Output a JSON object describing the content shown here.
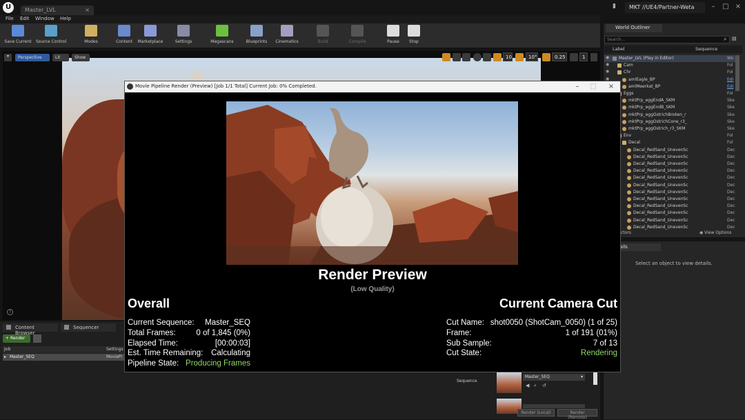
{
  "titlebar": {
    "doc_tab": "Master_LVL",
    "project": "MKT //UE4/Partner-Weta",
    "logo": "U"
  },
  "menu": [
    "File",
    "Edit",
    "Window",
    "Help"
  ],
  "toolbar": [
    {
      "label": "Save Current",
      "icon": "save-icon",
      "color": "#5a8ad8",
      "disabled": false
    },
    {
      "label": "Source Control",
      "icon": "source-control-icon",
      "color": "#5aa0c8",
      "disabled": false
    },
    {
      "label": "Modes",
      "icon": "modes-icon",
      "color": "#d0b060",
      "disabled": false
    },
    {
      "label": "Content",
      "icon": "content-icon",
      "color": "#6a8acc",
      "disabled": false
    },
    {
      "label": "Marketplace",
      "icon": "marketplace-icon",
      "color": "#8a9ad8",
      "disabled": false
    },
    {
      "label": "Settings",
      "icon": "settings-icon",
      "color": "#8a8aa8",
      "disabled": false
    },
    {
      "label": "Megascans",
      "icon": "megascans-icon",
      "color": "#6cc040",
      "disabled": false
    },
    {
      "label": "Blueprints",
      "icon": "blueprints-icon",
      "color": "#8aa0c8",
      "disabled": false
    },
    {
      "label": "Cinematics",
      "icon": "cinematics-icon",
      "color": "#a0a0c0",
      "disabled": false
    },
    {
      "label": "Build",
      "icon": "build-icon",
      "color": "#555555",
      "disabled": true
    },
    {
      "label": "Compile",
      "icon": "compile-icon",
      "color": "#555555",
      "disabled": true
    },
    {
      "label": "Pause",
      "icon": "pause-icon",
      "color": "#dcdcdc",
      "disabled": false
    },
    {
      "label": "Stop",
      "icon": "stop-icon",
      "color": "#dcdcdc",
      "disabled": false
    }
  ],
  "viewport": {
    "perspective": "Perspective",
    "lit": "Lit",
    "show": "Show",
    "grid_snap": "10",
    "rot_snap": "10°",
    "scale_snap": "0.25",
    "cam_speed": "1"
  },
  "outliner": {
    "tab": "World Outliner",
    "search_placeholder": "Search...",
    "col_label": "Label",
    "col_type": "Sequence",
    "rows": [
      {
        "name": "Master_LVL (Play in Editor)",
        "type": "Wo",
        "indent": 0,
        "kind": "level"
      },
      {
        "name": "Cam",
        "type": "Fol",
        "indent": 1,
        "kind": "folder"
      },
      {
        "name": "Chr",
        "type": "Fol",
        "indent": 1,
        "kind": "folder"
      },
      {
        "name": "amlEagle_BP",
        "type": "Edi",
        "indent": 2,
        "kind": "actor"
      },
      {
        "name": "amlMeerkat_BP",
        "type": "Edi",
        "indent": 2,
        "kind": "actor"
      },
      {
        "name": "Eggs",
        "type": "Fol",
        "indent": 1,
        "kind": "folder"
      },
      {
        "name": "mktPrp_eggEndA_SKM",
        "type": "Ske",
        "indent": 2,
        "kind": "actor"
      },
      {
        "name": "mktPrp_eggEndB_SKM",
        "type": "Ske",
        "indent": 2,
        "kind": "actor"
      },
      {
        "name": "mktPrp_eggOstrichBroken_r",
        "type": "Ske",
        "indent": 2,
        "kind": "actor"
      },
      {
        "name": "mktPrp_eggOstrichCone_r3_",
        "type": "Ske",
        "indent": 2,
        "kind": "actor"
      },
      {
        "name": "mktPrp_eggOstrich_r3_SKM",
        "type": "Ske",
        "indent": 2,
        "kind": "actor"
      },
      {
        "name": "Env",
        "type": "Fol",
        "indent": 1,
        "kind": "folder"
      },
      {
        "name": "Decal",
        "type": "Fol",
        "indent": 2,
        "kind": "folder"
      },
      {
        "name": "Decal_RedSand_UnevenSc",
        "type": "Dec",
        "indent": 3,
        "kind": "actor"
      },
      {
        "name": "Decal_RedSand_UnevenSc",
        "type": "Dec",
        "indent": 3,
        "kind": "actor"
      },
      {
        "name": "Decal_RedSand_UnevenSc",
        "type": "Dec",
        "indent": 3,
        "kind": "actor"
      },
      {
        "name": "Decal_RedSand_UnevenSc",
        "type": "Dec",
        "indent": 3,
        "kind": "actor"
      },
      {
        "name": "Decal_RedSand_UnevenSc",
        "type": "Dec",
        "indent": 3,
        "kind": "actor"
      },
      {
        "name": "Decal_RedSand_UnevenSc",
        "type": "Dec",
        "indent": 3,
        "kind": "actor"
      },
      {
        "name": "Decal_RedSand_UnevenSc",
        "type": "Dec",
        "indent": 3,
        "kind": "actor"
      },
      {
        "name": "Decal_RedSand_UnevenSc",
        "type": "Dec",
        "indent": 3,
        "kind": "actor"
      },
      {
        "name": "Decal_RedSand_UnevenSc",
        "type": "Dec",
        "indent": 3,
        "kind": "actor"
      },
      {
        "name": "Decal_RedSand_UnevenSc",
        "type": "Dec",
        "indent": 3,
        "kind": "actor"
      },
      {
        "name": "Decal_RedSand_UnevenSc",
        "type": "Dec",
        "indent": 3,
        "kind": "actor"
      },
      {
        "name": "Decal_RedSand_UnevenSc",
        "type": "Dec",
        "indent": 3,
        "kind": "actor"
      }
    ],
    "footer_left": "ctors",
    "view_options": "View Options"
  },
  "details": {
    "tab": "ails",
    "message": "Select an object to view details."
  },
  "bottom": {
    "content_browser": "Content Browser",
    "sequencer": "Sequencer",
    "render_button": "Render",
    "col_job": "Job",
    "col_settings": "Settings",
    "job_name": "Master_SEQ",
    "job_settings": "MoviePi",
    "sequence_label": "Sequence",
    "sequence_value": "Master_SEQ",
    "btn1": "Render (Local)",
    "btn2": "Render (Remote)"
  },
  "mpr": {
    "title": "Movie Pipeline Render (Preview) [Job 1/1 Total] Current Job: 0% Completed.",
    "heading": "Render Preview",
    "subheading": "(Low Quality)",
    "overall_title": "Overall",
    "camera_title": "Current Camera Cut",
    "overall": [
      {
        "label": "Current Sequence:",
        "value": "Master_SEQ"
      },
      {
        "label": "Total Frames:",
        "value": "0 of 1,845 (0%)"
      },
      {
        "label": "Elapsed Time:",
        "value": "[00:00:03]"
      },
      {
        "label": "Est. Time Remaining:",
        "value": "Calculating"
      },
      {
        "label": "Pipeline State:",
        "value": "Producing Frames",
        "color": "#8fd868"
      }
    ],
    "camera": [
      {
        "label": "Cut Name:",
        "value": "shot0050 (ShotCam_0050) (1 of 25)"
      },
      {
        "label": "Frame:",
        "value": "1 of 191 (01%)"
      },
      {
        "label": "Sub Sample:",
        "value": "7 of 13"
      },
      {
        "label": "Cut State:",
        "value": "Rendering",
        "color": "#8fd868"
      }
    ]
  }
}
